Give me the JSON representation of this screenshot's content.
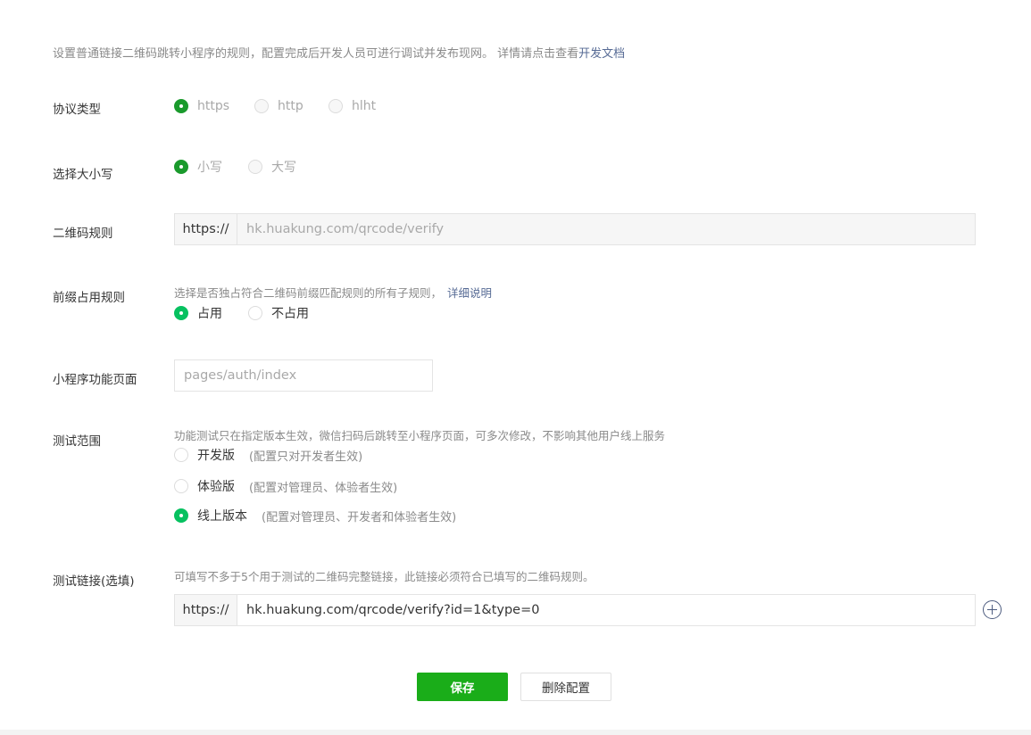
{
  "intro": {
    "text": "设置普通链接二维码跳转小程序的规则，配置完成后开发人员可进行调试并发布现网。 详情请点击查看",
    "link": "开发文档"
  },
  "protocol": {
    "label": "协议类型",
    "options": [
      "https",
      "http",
      "hlht"
    ],
    "selected": "https"
  },
  "case": {
    "label": "选择大小写",
    "options": [
      "小写",
      "大写"
    ],
    "selected": "小写"
  },
  "qrcode_rule": {
    "label": "二维码规则",
    "prefix": "https://",
    "value": "hk.huakung.com/qrcode/verify"
  },
  "prefix_rule": {
    "label": "前缀占用规则",
    "hint": "选择是否独占符合二维码前缀匹配规则的所有子规则，",
    "hint_link": "详细说明",
    "options": [
      "占用",
      "不占用"
    ],
    "selected": "占用"
  },
  "page_path": {
    "label": "小程序功能页面",
    "value": "pages/auth/index"
  },
  "test_scope": {
    "label": "测试范围",
    "hint": "功能测试只在指定版本生效，微信扫码后跳转至小程序页面，可多次修改，不影响其他用户线上服务",
    "options": [
      {
        "name": "开发版",
        "note": "(配置只对开发者生效)"
      },
      {
        "name": "体验版",
        "note": "(配置对管理员、体验者生效)"
      },
      {
        "name": "线上版本",
        "note": "(配置对管理员、开发者和体验者生效)"
      }
    ],
    "selected": "线上版本"
  },
  "test_link": {
    "label": "测试链接(选填)",
    "hint": "可填写不多于5个用于测试的二维码完整链接，此链接必须符合已填写的二维码规则。",
    "prefix": "https://",
    "value": "hk.huakung.com/qrcode/verify?id=1&type=0",
    "add_icon": "plus-circle-icon"
  },
  "actions": {
    "save": "保存",
    "delete": "删除配置"
  },
  "colors": {
    "primary": "#1aad19",
    "radio_on": "#07c160",
    "link": "#576b95"
  }
}
